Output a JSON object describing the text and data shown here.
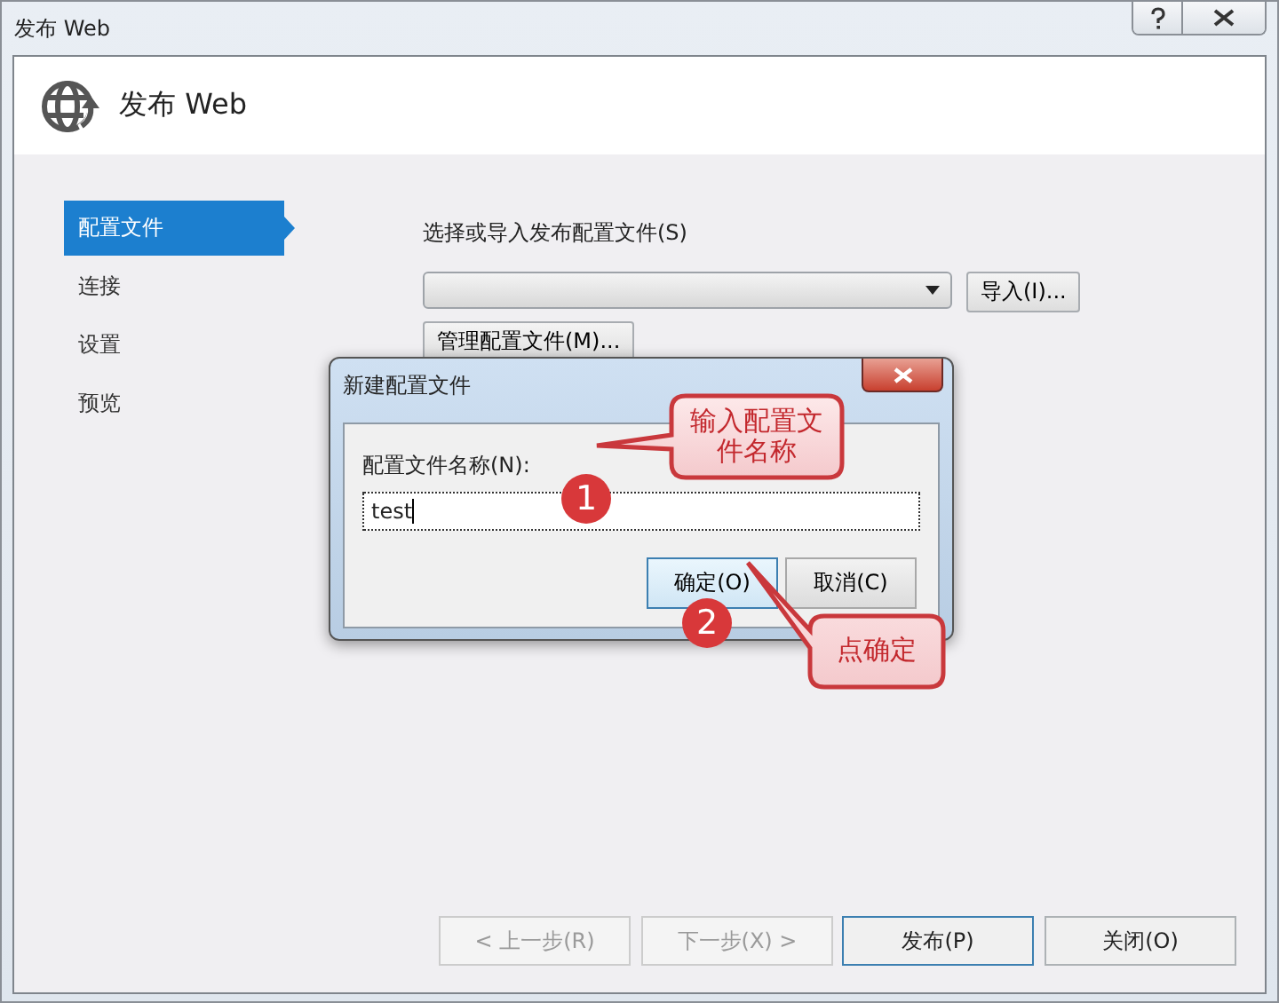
{
  "window": {
    "title": "发布 Web"
  },
  "header": {
    "title": "发布 Web"
  },
  "sidebar": {
    "items": [
      {
        "label": "配置文件",
        "selected": true
      },
      {
        "label": "连接",
        "selected": false
      },
      {
        "label": "设置",
        "selected": false
      },
      {
        "label": "预览",
        "selected": false
      }
    ]
  },
  "profile": {
    "label": "选择或导入发布配置文件(S)",
    "import_button": "导入(I)...",
    "manage_button": "管理配置文件(M)..."
  },
  "dialog": {
    "title": "新建配置文件",
    "field_label": "配置文件名称(N):",
    "field_value": "test",
    "ok_button": "确定(O)",
    "cancel_button": "取消(C)"
  },
  "footer": {
    "buttons": [
      {
        "label": "< 上一步(R)",
        "disabled": true,
        "default": false
      },
      {
        "label": "下一步(X) >",
        "disabled": true,
        "default": false
      },
      {
        "label": "发布(P)",
        "disabled": false,
        "default": true
      },
      {
        "label": "关闭(O)",
        "disabled": false,
        "default": false
      }
    ]
  },
  "annotations": {
    "callouts": [
      {
        "text": "输入配置文件名称"
      },
      {
        "text": "点确定"
      }
    ],
    "markers": [
      "1",
      "2"
    ]
  }
}
